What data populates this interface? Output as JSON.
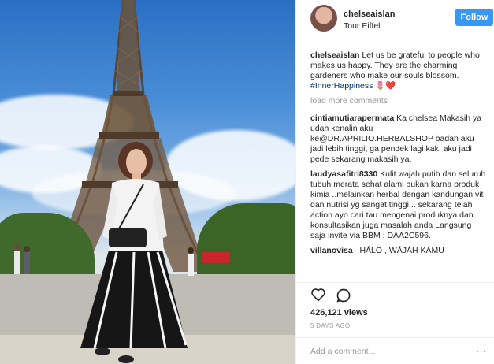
{
  "post": {
    "username": "chelseaislan",
    "location": "Tour Eiffel",
    "follow_label": "Follow",
    "caption_user": "chelseaislan",
    "caption_text": "Let us be grateful to people who makes us happy. They are the charming gardeners who make our souls blossom.",
    "caption_hashtag": "#InnerHappiness",
    "caption_emoji": "🌷❤️",
    "load_more": "load more comments"
  },
  "comments": [
    {
      "user": "cintiamutiarapermata",
      "text": "Ka chelsea Makasih ya udah kenalin aku ke@DR.APRILIO.HERBALSHOP badan aku jadi lebih tinggi, ga pendek lagi kak, aku jadi pede sekarang makasih ya."
    },
    {
      "user": "laudyasafitri8330",
      "text": "Kulit wajah putih dan seluruh tubuh merata sehat alami bukan karna produk kimia ..melainkan herbal dengan kandungan vit dan nutrisi yg sangat tinggi .. sekarang telah action ayo cari tau mengenai produknya dan konsultasikan juga masalah anda Langsung saja invite via BBM : DAA2C596."
    },
    {
      "user": "villanovisa_",
      "text": "HÁLO , WÁJÁH KÁMU"
    }
  ],
  "stats": {
    "views": "426,121 views",
    "date": "5 DAYS AGO"
  },
  "composer": {
    "placeholder": "Add a comment...",
    "more": "···"
  },
  "icons": {
    "like": "heart-icon",
    "comment": "comment-bubble-icon",
    "more": "more-options-icon"
  },
  "colors": {
    "follow_button": "#3897f0",
    "hashtag": "#003569",
    "muted": "#999999"
  }
}
